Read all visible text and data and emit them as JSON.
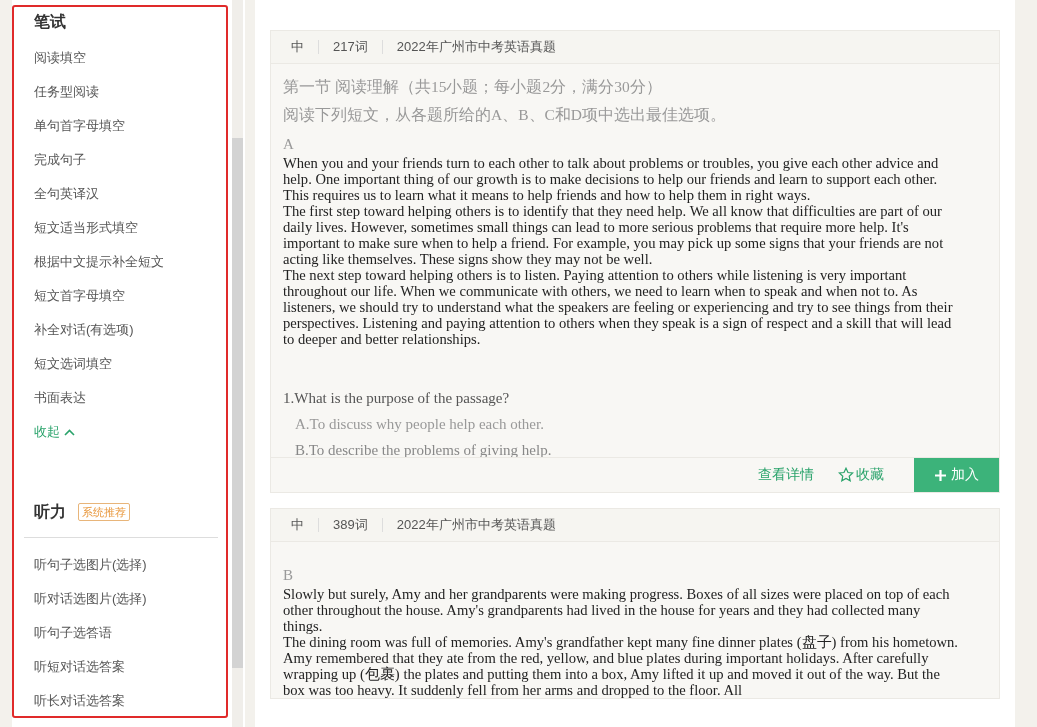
{
  "sidebar": {
    "written": {
      "title": "笔试",
      "items": [
        "阅读填空",
        "任务型阅读",
        "单句首字母填空",
        "完成句子",
        "全句英译汉",
        "短文适当形式填空",
        "根据中文提示补全短文",
        "短文首字母填空",
        "补全对话(有选项)",
        "短文选词填空",
        "书面表达"
      ]
    },
    "collapse": "收起",
    "listening": {
      "title": "听力",
      "badge": "系统推荐",
      "items": [
        "听句子选图片(选择)",
        "听对话选图片(选择)",
        "听句子选答语",
        "听短对话选答案",
        "听长对话选答案"
      ]
    }
  },
  "cards": [
    {
      "difficulty": "中",
      "words": "217词",
      "source": "2022年广州市中考英语真题",
      "section_title": "第一节 阅读理解（共15小题；每小题2分，满分30分）",
      "instruction": "阅读下列短文，从各题所给的A、B、C和D项中选出最佳选项。",
      "passage_label": "A",
      "paragraphs": [
        "When you and your friends turn to each other to talk about problems or troubles, you give each other advice and help. One important thing of our growth is to make decisions to help our friends and learn to support each other. This requires us to learn what it means to help friends and how to help them in right ways.",
        "The first step toward helping others is to identify that they need help. We all know that difficulties are part of our daily lives. However, sometimes small things can lead to more serious problems that require more help. It's important to make sure when to help a friend. For example, you may pick up some signs that your friends are not acting like themselves. These signs show they may not be well.",
        "The next step toward helping others is to listen. Paying attention to others while listening is very important throughout our life. When we communicate with others, we need to learn when to speak and when not to. As listeners, we should try to understand what the speakers are feeling or experiencing and try to see things from their perspectives. Listening and paying attention to others when they speak is a sign of respect and a skill that will lead to deeper and better relationships."
      ],
      "questions": [
        {
          "stem": "1.What is the purpose of the passage?",
          "options": [
            "A.To discuss why people help each other.",
            "B.To describe the problems of giving help."
          ]
        }
      ],
      "actions": {
        "detail": "查看详情",
        "favorite": "收藏",
        "add": "加入"
      }
    },
    {
      "difficulty": "中",
      "words": "389词",
      "source": "2022年广州市中考英语真题",
      "passage_label": "B",
      "paragraphs": [
        "Slowly but surely, Amy and her grandparents were making progress. Boxes of all sizes were placed on top of each other throughout the house. Amy's grandparents had lived in the house for years and they had collected many things.",
        "The dining room was full of memories. Amy's grandfather kept many fine dinner plates (盘子) from his hometown. Amy remembered that they ate from the red, yellow, and blue plates during important holidays. After carefully wrapping up (包裹) the plates and putting them into a box, Amy lifted it up and moved it out of the way. But the box was too heavy. It suddenly fell from her arms and dropped to the floor. All"
      ]
    }
  ]
}
